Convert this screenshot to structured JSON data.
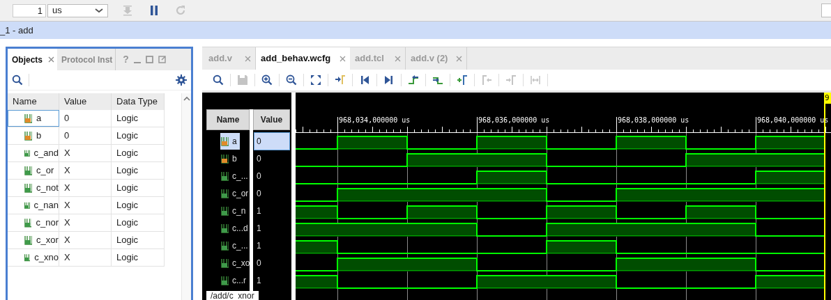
{
  "top_toolbar": {
    "run_time": "1",
    "time_unit": "us",
    "buttons": [
      {
        "kind": "run-for",
        "disabled": true
      },
      {
        "kind": "pause",
        "disabled": false
      },
      {
        "kind": "relaunch",
        "disabled": true
      }
    ]
  },
  "title_bar": {
    "title": "_1 - add"
  },
  "objects_panel": {
    "tabs": [
      {
        "label": "Objects",
        "selected": true,
        "closable": true
      },
      {
        "label": "Protocol Inst",
        "selected": false,
        "closable": false
      }
    ],
    "window_buttons": [
      "?"
    ],
    "columns": [
      "Name",
      "Value",
      "Data Type"
    ],
    "rows": [
      {
        "name": "a",
        "value": "0",
        "type": "Logic",
        "kind": "input",
        "selected": true
      },
      {
        "name": "b",
        "value": "0",
        "type": "Logic",
        "kind": "input",
        "selected": false
      },
      {
        "name": "c_and",
        "value": "X",
        "type": "Logic",
        "kind": "output",
        "selected": false
      },
      {
        "name": "c_or",
        "value": "X",
        "type": "Logic",
        "kind": "output",
        "selected": false
      },
      {
        "name": "c_not",
        "value": "X",
        "type": "Logic",
        "kind": "output",
        "selected": false
      },
      {
        "name": "c_nan",
        "value": "X",
        "type": "Logic",
        "kind": "output",
        "selected": false
      },
      {
        "name": "c_nor",
        "value": "X",
        "type": "Logic",
        "kind": "output",
        "selected": false
      },
      {
        "name": "c_xor",
        "value": "X",
        "type": "Logic",
        "kind": "output",
        "selected": false
      },
      {
        "name": "c_xno",
        "value": "X",
        "type": "Logic",
        "kind": "output",
        "selected": false
      }
    ]
  },
  "editor": {
    "tabs": [
      {
        "label": "add.v",
        "selected": false
      },
      {
        "label": "add_behav.wcfg",
        "selected": true
      },
      {
        "label": "add.tcl",
        "selected": false
      },
      {
        "label": "add.v (2)",
        "selected": false
      }
    ],
    "toolbar": [
      {
        "kind": "search",
        "disabled": false
      },
      {
        "kind": "save",
        "disabled": true
      },
      {
        "kind": "zoom-in",
        "disabled": false
      },
      {
        "kind": "zoom-out",
        "disabled": false
      },
      {
        "kind": "zoom-fit",
        "disabled": false
      },
      {
        "kind": "go-to-cursor",
        "disabled": false
      },
      {
        "kind": "go-to-start",
        "disabled": false
      },
      {
        "kind": "go-to-end",
        "disabled": false
      },
      {
        "kind": "prev-transition",
        "disabled": false
      },
      {
        "kind": "next-transition",
        "disabled": false
      },
      {
        "kind": "add-marker",
        "disabled": false
      },
      {
        "kind": "prev-marker",
        "disabled": true
      },
      {
        "kind": "next-marker",
        "disabled": true
      },
      {
        "kind": "swap-markers",
        "disabled": true
      }
    ],
    "name_header": "Name",
    "value_header": "Value",
    "signals": [
      {
        "name": "a",
        "value": "0",
        "kind": "input",
        "selected": true,
        "high": [
          false,
          true,
          false,
          true,
          false,
          true,
          false,
          true
        ]
      },
      {
        "name": "b",
        "value": "0",
        "kind": "input",
        "selected": false,
        "high": [
          false,
          false,
          true,
          true,
          false,
          false,
          true,
          true
        ]
      },
      {
        "name": "c_...",
        "value": "0",
        "kind": "output",
        "selected": false,
        "high": [
          false,
          false,
          false,
          true,
          false,
          false,
          false,
          true
        ]
      },
      {
        "name": "c_or",
        "value": "0",
        "kind": "output",
        "selected": false,
        "high": [
          false,
          true,
          true,
          true,
          false,
          true,
          true,
          true
        ]
      },
      {
        "name": "c_n",
        "value": "1",
        "kind": "output",
        "selected": false,
        "high": [
          true,
          false,
          true,
          false,
          true,
          false,
          true,
          false
        ]
      },
      {
        "name": "c...d",
        "value": "1",
        "kind": "output",
        "selected": false,
        "high": [
          true,
          true,
          true,
          false,
          true,
          true,
          true,
          false
        ]
      },
      {
        "name": "c_...",
        "value": "1",
        "kind": "output",
        "selected": false,
        "high": [
          true,
          false,
          false,
          false,
          true,
          false,
          false,
          false
        ]
      },
      {
        "name": "c_xo",
        "value": "0",
        "kind": "output",
        "selected": false,
        "high": [
          false,
          true,
          true,
          false,
          false,
          true,
          true,
          false
        ]
      },
      {
        "name": "c...r",
        "value": "1",
        "kind": "output",
        "selected": false,
        "high": [
          true,
          false,
          false,
          true,
          true,
          false,
          false,
          true
        ]
      }
    ],
    "time_labels": [
      "968,034,000000 us",
      "968,036,000000 us",
      "968,038,000000 us",
      "968,040,000000 us"
    ],
    "tooltip": "/add/c_xnor",
    "cursor_label": "9"
  }
}
